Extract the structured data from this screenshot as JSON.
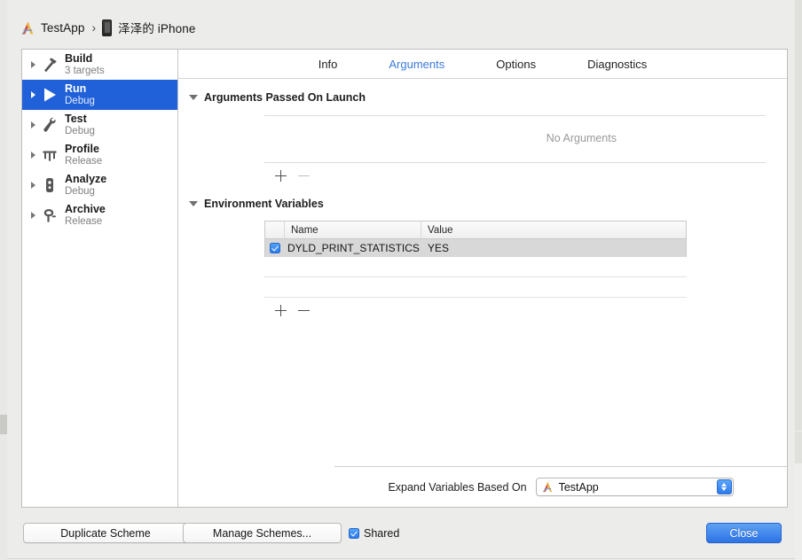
{
  "breadcrumb": {
    "scheme_icon": "xcode-app-icon",
    "scheme_name": "TestApp",
    "separator": "›",
    "device_icon": "iphone-icon",
    "device_name": "泽泽的 iPhone"
  },
  "sidebar": {
    "items": [
      {
        "title": "Build",
        "subtitle": "3 targets",
        "icon": "hammer-icon",
        "selected": false
      },
      {
        "title": "Run",
        "subtitle": "Debug",
        "icon": "play-icon",
        "selected": true
      },
      {
        "title": "Test",
        "subtitle": "Debug",
        "icon": "wrench-icon",
        "selected": false
      },
      {
        "title": "Profile",
        "subtitle": "Release",
        "icon": "gauge-icon",
        "selected": false
      },
      {
        "title": "Analyze",
        "subtitle": "Debug",
        "icon": "microscope-icon",
        "selected": false
      },
      {
        "title": "Archive",
        "subtitle": "Release",
        "icon": "archive-icon",
        "selected": false
      }
    ]
  },
  "tabs": [
    {
      "label": "Info",
      "active": false
    },
    {
      "label": "Arguments",
      "active": true
    },
    {
      "label": "Options",
      "active": false
    },
    {
      "label": "Diagnostics",
      "active": false
    }
  ],
  "arguments_section": {
    "title": "Arguments Passed On Launch",
    "empty_text": "No Arguments",
    "add_button": "+",
    "remove_button": "−",
    "add_enabled": true,
    "remove_enabled": false
  },
  "environment_section": {
    "title": "Environment Variables",
    "columns": [
      "Name",
      "Value"
    ],
    "rows": [
      {
        "checked": true,
        "name": "DYLD_PRINT_STATISTICS",
        "value": "YES",
        "selected": true
      }
    ],
    "add_button": "+",
    "remove_button": "−",
    "add_enabled": true,
    "remove_enabled": true
  },
  "expand_variables": {
    "label": "Expand Variables Based On",
    "icon": "xcode-app-icon",
    "selected_value": "TestApp",
    "options": [
      "TestApp"
    ]
  },
  "bottom_bar": {
    "duplicate_scheme": "Duplicate Scheme",
    "manage_schemes": "Manage Schemes...",
    "shared_label": "Shared",
    "shared_checked": true,
    "close": "Close"
  },
  "colors": {
    "accent_blue": "#2060d8",
    "tab_active": "#3a7ae0",
    "checkbox_blue": "#2a7cee",
    "row_selected": "#d8d8d8",
    "window_chrome": "#ececea"
  }
}
